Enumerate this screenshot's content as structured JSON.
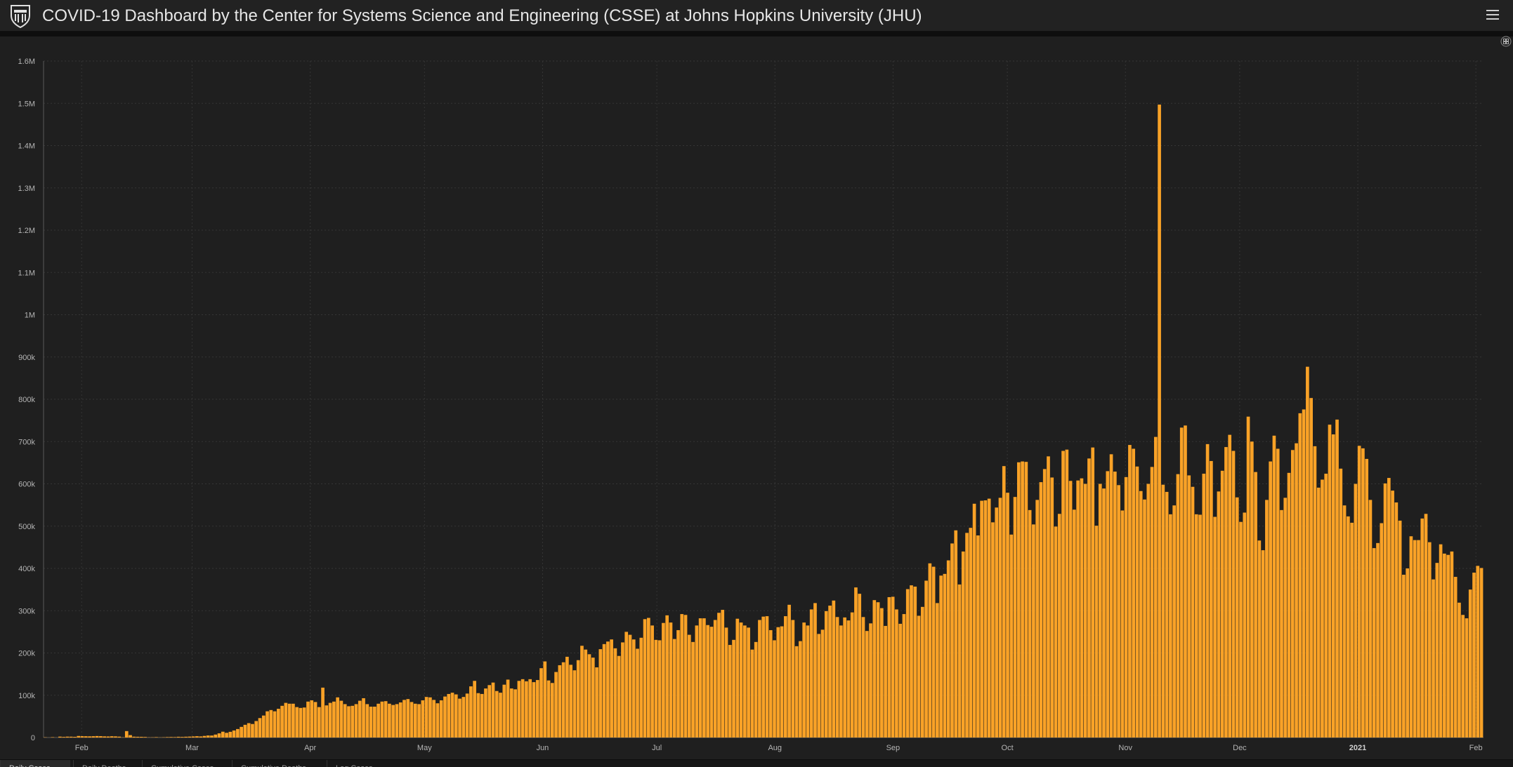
{
  "header": {
    "title": "COVID-19 Dashboard by the Center for Systems Science and Engineering (CSSE) at Johns Hopkins University (JHU)",
    "logo_icon": "jhu-shield-icon",
    "menu_icon": "hamburger-menu-icon"
  },
  "panel": {
    "expand_icon": "expand-icon"
  },
  "tabs": [
    {
      "label": "Daily Cases",
      "active": true
    },
    {
      "label": "Daily Deaths",
      "active": false
    },
    {
      "label": "Cumulative Cases",
      "active": false
    },
    {
      "label": "Cumulative Deaths",
      "active": false
    },
    {
      "label": "Log Cases",
      "active": false
    }
  ],
  "chart_data": {
    "type": "bar",
    "color": "#f9a227",
    "ylim": [
      0,
      1600000
    ],
    "yticks": [
      {
        "v": 0,
        "l": "0"
      },
      {
        "v": 100000,
        "l": "100k"
      },
      {
        "v": 200000,
        "l": "200k"
      },
      {
        "v": 300000,
        "l": "300k"
      },
      {
        "v": 400000,
        "l": "400k"
      },
      {
        "v": 500000,
        "l": "500k"
      },
      {
        "v": 600000,
        "l": "600k"
      },
      {
        "v": 700000,
        "l": "700k"
      },
      {
        "v": 800000,
        "l": "800k"
      },
      {
        "v": 900000,
        "l": "900k"
      },
      {
        "v": 1000000,
        "l": "1M"
      },
      {
        "v": 1100000,
        "l": "1.1M"
      },
      {
        "v": 1200000,
        "l": "1.2M"
      },
      {
        "v": 1300000,
        "l": "1.3M"
      },
      {
        "v": 1400000,
        "l": "1.4M"
      },
      {
        "v": 1500000,
        "l": "1.5M"
      },
      {
        "v": 1600000,
        "l": "1.6M"
      }
    ],
    "x_start": "2020-01-22",
    "x_end": "2021-02-03",
    "xticks": [
      {
        "date": "2020-02-01",
        "l": "Feb"
      },
      {
        "date": "2020-03-01",
        "l": "Mar"
      },
      {
        "date": "2020-04-01",
        "l": "Apr"
      },
      {
        "date": "2020-05-01",
        "l": "May"
      },
      {
        "date": "2020-06-01",
        "l": "Jun"
      },
      {
        "date": "2020-07-01",
        "l": "Jul"
      },
      {
        "date": "2020-08-01",
        "l": "Aug"
      },
      {
        "date": "2020-09-01",
        "l": "Sep"
      },
      {
        "date": "2020-10-01",
        "l": "Oct"
      },
      {
        "date": "2020-11-01",
        "l": "Nov"
      },
      {
        "date": "2020-12-01",
        "l": "Dec"
      },
      {
        "date": "2021-01-01",
        "l": "2021",
        "bold": true
      },
      {
        "date": "2021-02-01",
        "l": "Feb"
      }
    ],
    "values": [
      600,
      100,
      900,
      100,
      2100,
      1500,
      2100,
      2000,
      1700,
      3700,
      3200,
      3000,
      2800,
      3100,
      3500,
      3200,
      2700,
      2500,
      3000,
      2700,
      2100,
      500,
      15200,
      5700,
      2000,
      1800,
      1700,
      1400,
      500,
      600,
      1000,
      400,
      700,
      1100,
      1300,
      1100,
      1800,
      1500,
      1900,
      2200,
      2600,
      3100,
      2600,
      3800,
      4800,
      4700,
      7000,
      9900,
      13800,
      11100,
      13500,
      16700,
      20100,
      25200,
      30100,
      34000,
      32000,
      39000,
      46000,
      52000,
      62000,
      65000,
      62000,
      68000,
      75000,
      82000,
      80000,
      80000,
      72000,
      70000,
      71000,
      85000,
      88000,
      84000,
      72000,
      118000,
      76000,
      82000,
      85000,
      95000,
      87000,
      79000,
      74000,
      75000,
      79000,
      87000,
      93000,
      79000,
      73000,
      73000,
      80000,
      85000,
      86000,
      80000,
      77000,
      79000,
      83000,
      89000,
      91000,
      84000,
      80000,
      79000,
      88000,
      96000,
      95000,
      89000,
      81000,
      88000,
      97000,
      103000,
      106000,
      102000,
      92000,
      96000,
      104000,
      121000,
      134000,
      105000,
      103000,
      116000,
      124000,
      130000,
      110000,
      106000,
      125000,
      137000,
      116000,
      114000,
      134000,
      138000,
      133000,
      138000,
      131000,
      136000,
      164000,
      180000,
      135000,
      129000,
      155000,
      171000,
      178000,
      191000,
      172000,
      159000,
      183000,
      217000,
      208000,
      197000,
      189000,
      166000,
      209000,
      221000,
      227000,
      232000,
      211000,
      193000,
      225000,
      250000,
      243000,
      232000,
      210000,
      236000,
      280000,
      283000,
      265000,
      231000,
      230000,
      271000,
      289000,
      272000,
      233000,
      254000,
      292000,
      290000,
      243000,
      226000,
      265000,
      282000,
      282000,
      266000,
      262000,
      278000,
      295000,
      302000,
      260000,
      219000,
      231000,
      281000,
      272000,
      265000,
      260000,
      208000,
      226000,
      278000,
      286000,
      287000,
      254000,
      230000,
      261000,
      263000,
      287000,
      314000,
      278000,
      216000,
      228000,
      272000,
      265000,
      303000,
      318000,
      245000,
      255000,
      299000,
      312000,
      324000,
      285000,
      265000,
      284000,
      277000,
      296000,
      355000,
      340000,
      285000,
      252000,
      270000,
      325000,
      320000,
      306000,
      264000,
      332000,
      333000,
      303000,
      269000,
      292000,
      351000,
      360000,
      357000,
      288000,
      309000,
      371000,
      412000,
      404000,
      318000,
      383000,
      387000,
      419000,
      459000,
      490000,
      362000,
      440000,
      484000,
      496000,
      553000,
      478000,
      560000,
      561000,
      565000,
      509000,
      544000,
      567000,
      642000,
      579000,
      480000,
      569000,
      651000,
      653000,
      652000,
      538000,
      504000,
      562000,
      604000,
      635000,
      665000,
      615000,
      499000,
      529000,
      678000,
      681000,
      607000,
      539000,
      608000,
      613000,
      600000,
      660000,
      686000,
      501000,
      600000,
      589000,
      630000,
      670000,
      629000,
      597000,
      537000,
      616000,
      692000,
      683000,
      641000,
      583000,
      563000,
      600000,
      640000,
      711000,
      1497000,
      598000,
      581000,
      528000,
      549000,
      623000,
      733000,
      738000,
      620000,
      593000,
      528000,
      527000,
      624000,
      694000,
      654000,
      522000,
      582000,
      631000,
      687000,
      716000,
      678000,
      568000,
      510000,
      532000,
      759000,
      700000,
      628000,
      466000,
      443000,
      562000,
      653000,
      714000,
      683000,
      538000,
      567000,
      626000,
      680000,
      696000,
      767000,
      776000,
      877000,
      803000,
      689000,
      591000,
      610000,
      624000,
      740000,
      717000,
      752000,
      636000,
      549000,
      523000,
      508000,
      600000,
      690000,
      684000,
      659000,
      562000,
      448000,
      460000,
      507000,
      601000,
      614000,
      584000,
      556000,
      513000,
      385000,
      400000,
      476000,
      467000,
      467000,
      518000,
      529000,
      462000,
      374000,
      413000,
      457000,
      435000,
      432000,
      440000,
      380000,
      319000,
      290000,
      282000,
      350000,
      390000,
      406000,
      401000
    ]
  }
}
